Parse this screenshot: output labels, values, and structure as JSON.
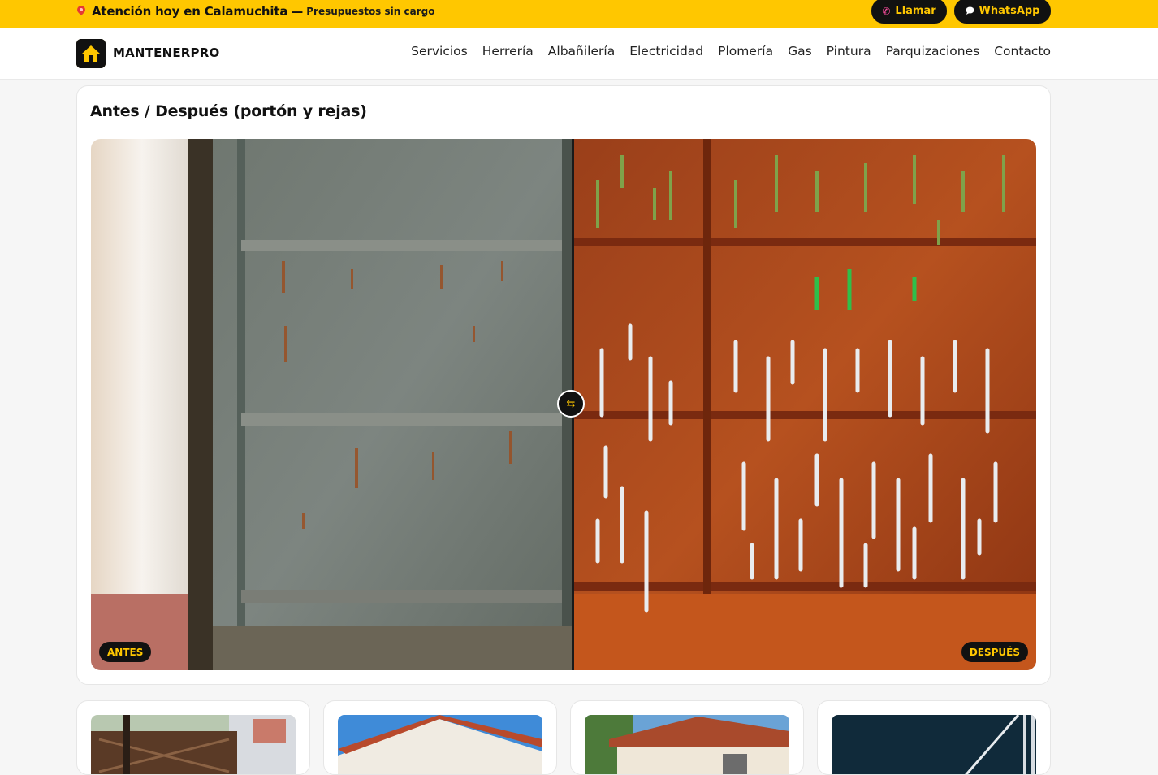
{
  "topbar": {
    "location_icon": "map-pin-icon",
    "headline": "Atención hoy en Calamuchita",
    "separator": "—",
    "subline": "Presupuestos sin cargo",
    "call_icon": "phone-icon",
    "call_label": "Llamar",
    "whatsapp_icon": "chat-bubble-icon",
    "whatsapp_label": "WhatsApp"
  },
  "header": {
    "logo_icon": "house-icon",
    "brand": "MANTENERPRO",
    "menu": [
      "Servicios",
      "Herrería",
      "Albañilería",
      "Electricidad",
      "Plomería",
      "Gas",
      "Pintura",
      "Parquizaciones",
      "Contacto"
    ]
  },
  "comparison": {
    "title": "Antes / Después (portón y rejas)",
    "before_label": "ANTES",
    "after_label": "DESPUÉS",
    "handle_icon": "swap-arrows-icon",
    "split_fraction": 0.51
  },
  "gallery": {
    "thumbnails": [
      "wooden-gate-photo",
      "house-roof-photo",
      "house-facade-photo",
      "dark-railing-photo"
    ]
  },
  "colors": {
    "accent": "#ffc700",
    "dark": "#111111",
    "background": "#f6f6f6"
  }
}
